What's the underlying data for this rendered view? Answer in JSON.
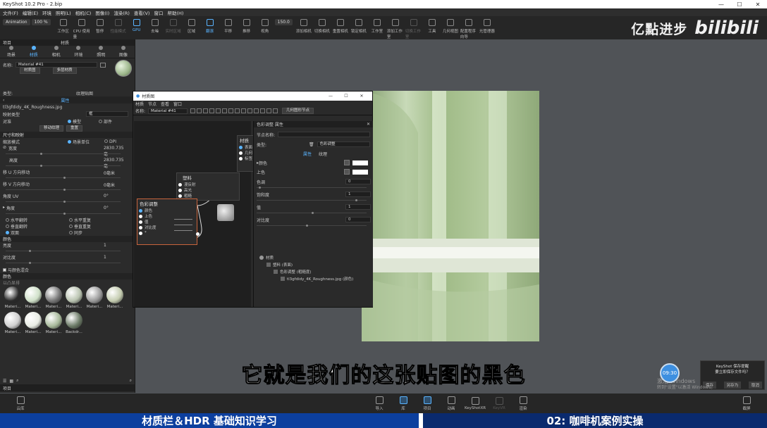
{
  "app": {
    "title": "KeyShot 10.2 Pro  - 2.bip",
    "win_min": "—",
    "win_max": "☐",
    "win_close": "✕"
  },
  "menu": [
    "文件(F)",
    "编辑(E)",
    "环境",
    "照明(L)",
    "相机(C)",
    "图像(I)",
    "渲染(R)",
    "查看(V)",
    "窗口",
    "帮助(H)"
  ],
  "toolbar": {
    "preset": "Animation",
    "zoom": "100 %",
    "fps": "150.0",
    "items": [
      {
        "label": "工作区",
        "icon": "workspace-icon"
      },
      {
        "label": "CPU 使用量",
        "icon": "cpu-icon"
      },
      {
        "label": "暂停",
        "icon": "pause-icon"
      },
      {
        "label": "性能模式",
        "icon": "performance-icon",
        "dim": true
      },
      {
        "label": "GPU",
        "icon": "gpu-icon",
        "active": true
      },
      {
        "label": "去噪",
        "icon": "denoise-icon"
      },
      {
        "label": "实时区域",
        "icon": "region-icon",
        "dim": true
      },
      {
        "label": "区域",
        "icon": "area-icon"
      },
      {
        "label": "翻滚",
        "icon": "tumble-icon",
        "active": true
      },
      {
        "label": "平移",
        "icon": "pan-icon"
      },
      {
        "label": "推移",
        "icon": "dolly-icon"
      },
      {
        "label": "视角",
        "icon": "view-icon"
      },
      {
        "label": "添加相机",
        "icon": "add-camera-icon"
      },
      {
        "label": "切换相机",
        "icon": "switch-camera-icon"
      },
      {
        "label": "重置相机",
        "icon": "reset-camera-icon"
      },
      {
        "label": "锁定相机",
        "icon": "lock-camera-icon"
      },
      {
        "label": "工作室",
        "icon": "studio-icon"
      },
      {
        "label": "添加工作室",
        "icon": "add-studio-icon"
      },
      {
        "label": "切换工作室",
        "icon": "switch-studio-icon",
        "dim": true
      },
      {
        "label": "工具",
        "icon": "tools-icon"
      },
      {
        "label": "几何视图",
        "icon": "geometry-view-icon"
      },
      {
        "label": "配置程序向导",
        "icon": "configurator-icon"
      },
      {
        "label": "光管理器",
        "icon": "light-manager-icon"
      }
    ]
  },
  "watermark": {
    "text": "亿點进步",
    "brand": "bilibili"
  },
  "left_panel": {
    "header_left": "项目",
    "header_right": "材质",
    "tabs": [
      "场景",
      "材质",
      "相机",
      "环境",
      "照明",
      "图像"
    ],
    "name_label": "名称:",
    "name_value": "Material #41",
    "btn_graph": "材质图",
    "btn_multi": "多层材质",
    "type_label": "类型:",
    "type_value": "纹理贴图",
    "props_tab": "属性",
    "texture_file": "tl3gfdidy_4K_Roughness.jpg",
    "map_type_label": "映射类型",
    "map_type_value": "框",
    "align_label": "对准",
    "align_model": "模型",
    "align_part": "部件",
    "btn_move": "移动纹理",
    "btn_reset": "重置",
    "sec_size": "尺寸和映射",
    "scale_mode_label": "缩放模式",
    "scale_unit": "场景单位",
    "scale_dpi": "DPI",
    "width_label": "宽度",
    "width_value": "2830.735毫",
    "height_label": "高度",
    "height_value": "2830.735毫",
    "moveu_label": "移 U 方向移动",
    "moveu_value": "0毫米",
    "movev_label": "移 V 方向移动",
    "movev_value": "0毫米",
    "angleuv_label": "角度 UV",
    "angleuv_value": "0°",
    "angle_label": "角度",
    "angle_value": "0°",
    "flip_h": "水平翻转",
    "repeat_h": "水平重复",
    "flip_v": "垂直翻转",
    "repeat_v": "垂直重复",
    "double": "双面",
    "sync": "同步",
    "sec_color": "颜色",
    "bright_label": "亮度",
    "bright_value": "1",
    "contrast_label": "对比度",
    "contrast_value": "1",
    "blend_label": "与颜色混合",
    "sec_library": "颜色",
    "lib_sort": "以凸显排",
    "library": [
      {
        "name": "Materi...",
        "color": "#2a2a2a"
      },
      {
        "name": "Materi...",
        "color": "#cfe0c8"
      },
      {
        "name": "Materi...",
        "color": "#777777"
      },
      {
        "name": "Materi...",
        "color": "#b9c3b0"
      },
      {
        "name": "Materi...",
        "color": "#9a9a9a"
      },
      {
        "name": "Materi...",
        "color": "#c4ccb0"
      },
      {
        "name": "Materi...",
        "color": "#cfcfcf"
      },
      {
        "name": "Materi...",
        "color": "#e8ece4"
      },
      {
        "name": "Materi...",
        "color": "#a7b99a"
      },
      {
        "name": "Backdr...",
        "color": "#6b7a66"
      }
    ],
    "footer_tab": "项目",
    "footer_btn": "云库"
  },
  "graph_window": {
    "title": "材质图",
    "menu": [
      "材质",
      "节点",
      "查看",
      "窗口"
    ],
    "name_label": "名称:",
    "name_value": "Material #41",
    "geo_node_btn": "几何图形节点",
    "nodes": {
      "material": {
        "title": "材质",
        "ports": [
          "表面",
          "几何",
          "标签"
        ]
      },
      "plastic": {
        "title": "塑料",
        "ports": [
          "漫反射",
          "高光",
          "粗糙"
        ]
      },
      "color_adjust": {
        "title": "色彩调整",
        "ports": [
          "颜色",
          "上色",
          "值",
          "对比度",
          "*"
        ]
      }
    },
    "props": {
      "header": "色彩调整 属性",
      "node_name_label": "节点名称:",
      "type_label": "类型:",
      "type_value": "色彩调整",
      "tab_props": "属性",
      "tab_texture": "纹理",
      "color_label": "颜色",
      "tint_label": "上色",
      "hue_label": "色调",
      "hue_value": "0",
      "sat_label": "饱和度",
      "sat_value": "1",
      "value_label": "值",
      "value_value": "1",
      "contrast_label": "对比度",
      "contrast_value": "0",
      "tree": [
        {
          "label": "材质",
          "indent": 0
        },
        {
          "label": "塑料 (表面)",
          "indent": 1
        },
        {
          "label": "色彩调整 (粗糙度)",
          "indent": 2
        },
        {
          "label": "tl3gfdidy_4K_Roughness.jpg (颜色)",
          "indent": 3
        }
      ]
    }
  },
  "subtitle": "它就是我们的这张贴图的黑色",
  "bottom_bar": [
    {
      "label": "导入",
      "icon": "import-icon"
    },
    {
      "label": "库",
      "icon": "library-icon",
      "on": true
    },
    {
      "label": "项目",
      "icon": "project-icon",
      "on": true
    },
    {
      "label": "动画",
      "icon": "animation-icon"
    },
    {
      "label": "KeyShotXR",
      "icon": "keyshotxr-icon"
    },
    {
      "label": "KeyVR",
      "icon": "keyvr-icon",
      "dim": true
    },
    {
      "label": "渲染",
      "icon": "render-icon"
    },
    {
      "label": "截屏",
      "icon": "screenshot-icon"
    }
  ],
  "notify": {
    "title": "KeyShot 保存提醒",
    "msg": "要立即保存文件吗？",
    "save": "保存",
    "save_as": "另存为",
    "cancel": "取消"
  },
  "win_activate": {
    "line1": "激活 Windows",
    "line2": "转到\"设置\"以激活 Windows。"
  },
  "clock": "09:30",
  "banner": {
    "left": "材质栏＆HDR 基础知识学习",
    "right": "02: 咖啡机案例实操"
  }
}
